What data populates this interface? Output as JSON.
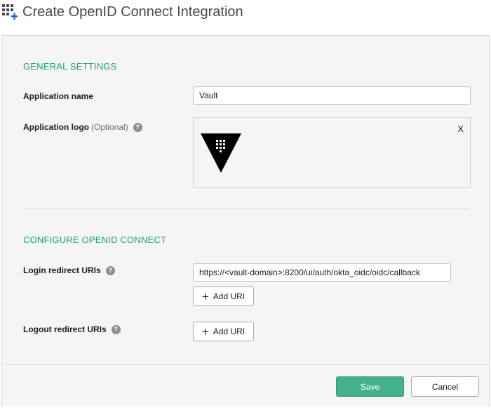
{
  "header": {
    "title": "Create OpenID Connect Integration",
    "icon": "grid-plus-icon"
  },
  "general": {
    "heading": "GENERAL SETTINGS",
    "app_name_label": "Application name",
    "app_name_value": "Vault",
    "app_logo_label": "Application logo",
    "app_logo_optional": "(Optional)",
    "help_glyph": "?",
    "logo_remove": "X",
    "logo_icon": "vault-logo"
  },
  "oidc": {
    "heading": "CONFIGURE OPENID CONNECT",
    "login_label": "Login redirect URIs",
    "login_value": "https://<vault-domain>:8200/ui/auth/okta_oidc/oidc/callback",
    "add_uri_label": "Add URI",
    "logout_label": "Logout redirect URIs"
  },
  "footer": {
    "save_label": "Save",
    "cancel_label": "Cancel"
  },
  "colors": {
    "accent_green": "#1aa07a",
    "save_green": "#45b18a",
    "panel_bg": "#f5f5f6"
  }
}
